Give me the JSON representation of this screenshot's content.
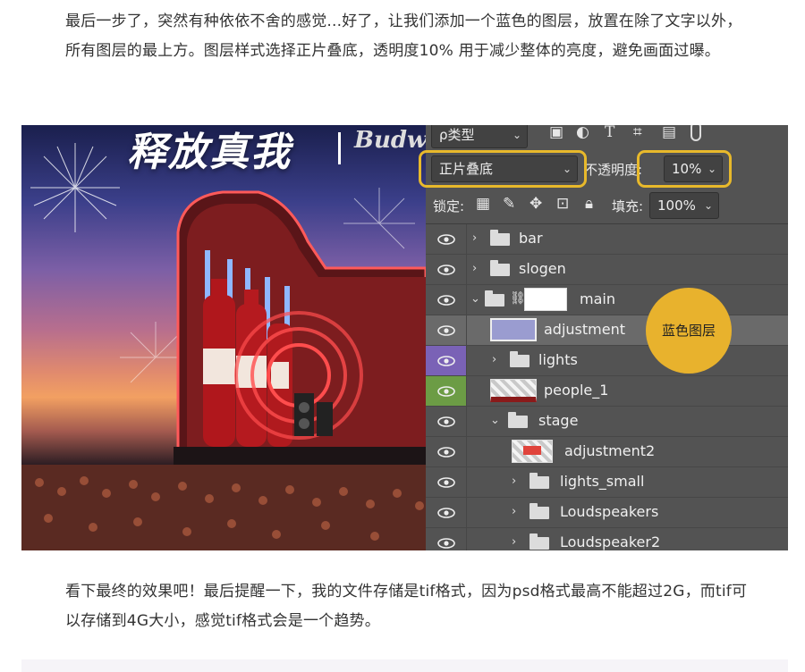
{
  "article": {
    "para1": "最后一步了，突然有种依依不舍的感觉...好了，让我们添加一个蓝色的图层，放置在除了文字以外，所有图层的最上方。图层样式选择正片叠底，透明度10% 用于减少整体的亮度，避免画面过曝。",
    "para2": "看下最终的效果吧！最后提醒一下，我的文件存储是tif格式，因为psd格式最高不能超过2G，而tif可以存储到4G大小，感觉tif格式会是一个趋势。"
  },
  "poster": {
    "title": "释放真我",
    "brand": "Budwe"
  },
  "panel": {
    "filter_label": "ρ类型",
    "blend_mode": "正片叠底",
    "opacity_label": "不透明度:",
    "opacity_value": "10%",
    "lock_label": "锁定:",
    "fill_label": "填充:",
    "fill_value": "100%",
    "layers": [
      {
        "name": "bar"
      },
      {
        "name": "slogen"
      },
      {
        "name": "main"
      },
      {
        "name": "adjustment"
      },
      {
        "name": "lights"
      },
      {
        "name": "people_1"
      },
      {
        "name": "stage"
      },
      {
        "name": "adjustment2"
      },
      {
        "name": "lights_small"
      },
      {
        "name": "Loudspeakers"
      },
      {
        "name": "Loudspeaker2"
      }
    ],
    "callout": "蓝色图层"
  },
  "colors": {
    "highlight": "#e8b92b",
    "callout": "#e8b22d",
    "panel_bg": "#535353",
    "blue_layer": "#9a9cd0"
  }
}
